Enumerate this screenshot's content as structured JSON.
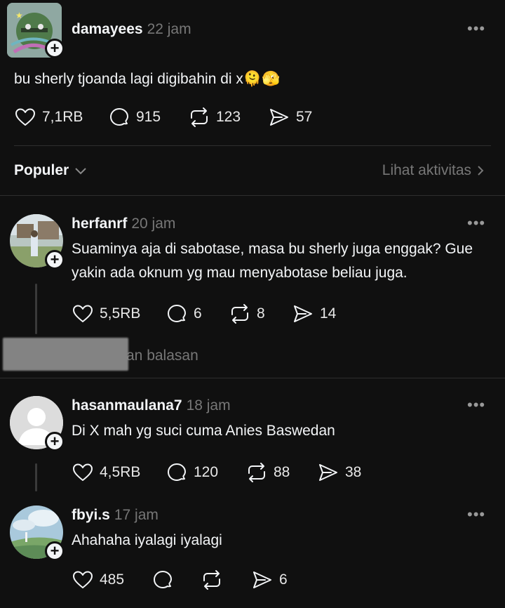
{
  "post": {
    "username": "damayees",
    "time": "22 jam",
    "text": "bu sherly tjoanda lagi digibahin di x",
    "emoji1": "🫠",
    "emoji2": "🫣",
    "likes": "7,1RB",
    "comments": "915",
    "reposts": "123",
    "shares": "57"
  },
  "filter": {
    "label": "Populer",
    "activity_link": "Lihat aktivitas"
  },
  "comments": [
    {
      "username": "herfanrf",
      "time": "20 jam",
      "text": "Suaminya aja di sabotase, masa bu sherly juga enggak? Gue yakin ada oknum yg mau menyabotase beliau juga.",
      "likes": "5,5RB",
      "comments": "6",
      "reposts": "8",
      "shares": "14",
      "replies_label": "an balasan"
    },
    {
      "username": "hasanmaulana7",
      "time": "18 jam",
      "text": "Di X mah yg suci cuma Anies Baswedan",
      "likes": "4,5RB",
      "comments": "120",
      "reposts": "88",
      "shares": "38"
    },
    {
      "username": "fbyi.s",
      "time": "17 jam",
      "text": "Ahahaha iyalagi iyalagi",
      "likes": "485",
      "comments": "",
      "reposts": "",
      "shares": "6"
    }
  ],
  "colors": {
    "background": "#101010",
    "text": "#f3f5f7",
    "muted": "#777777",
    "divider": "#2e2e2e"
  }
}
